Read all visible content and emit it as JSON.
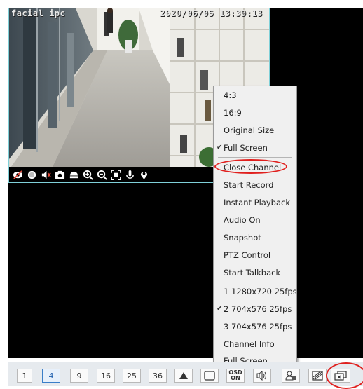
{
  "camera": {
    "name_overlay": "facial ipc",
    "timestamp_overlay": "2020/06/05 13:39:13",
    "controls": [
      {
        "name": "eye-off-icon"
      },
      {
        "name": "record-icon"
      },
      {
        "name": "mute-icon"
      },
      {
        "name": "camera-icon"
      },
      {
        "name": "ptz-icon"
      },
      {
        "name": "zoom-in-icon"
      },
      {
        "name": "zoom-out-icon"
      },
      {
        "name": "fit-screen-icon"
      },
      {
        "name": "microphone-icon"
      },
      {
        "name": "location-pin-icon"
      }
    ]
  },
  "context_menu": {
    "items": [
      {
        "label": "4:3",
        "checked": false
      },
      {
        "label": "16:9",
        "checked": false
      },
      {
        "label": "Original Size",
        "checked": false
      },
      {
        "label": "Full Screen",
        "checked": true
      },
      {
        "label": "Close Channel",
        "checked": false,
        "highlighted": true
      },
      {
        "label": "Start Record",
        "checked": false
      },
      {
        "label": "Instant Playback",
        "checked": false
      },
      {
        "label": "Audio On",
        "checked": false
      },
      {
        "label": "Snapshot",
        "checked": false
      },
      {
        "label": "PTZ Control",
        "checked": false
      },
      {
        "label": "Start Talkback",
        "checked": false
      },
      {
        "label": "1 1280x720 25fps",
        "checked": false
      },
      {
        "label": "2 704x576 25fps",
        "checked": true
      },
      {
        "label": "3 704x576 25fps",
        "checked": false
      },
      {
        "label": "Channel Info",
        "checked": false
      },
      {
        "label": "Full Screen",
        "checked": false
      }
    ],
    "check_glyph": "✔"
  },
  "toolbar": {
    "layouts": [
      "1",
      "4",
      "9",
      "16",
      "25",
      "36"
    ],
    "active_layout": "4",
    "osd_label_top": "OSD",
    "osd_label_bottom": "ON",
    "icons": [
      "ptz-up-icon",
      "fullscreen-window-icon",
      "osd-icon",
      "audio-icon",
      "user-lock-icon",
      "tour-icon",
      "close-all-icon"
    ]
  },
  "colors": {
    "highlight": "#e0201e",
    "selected_border": "#7fd0d8",
    "active_layout": "#3a7ec8"
  }
}
